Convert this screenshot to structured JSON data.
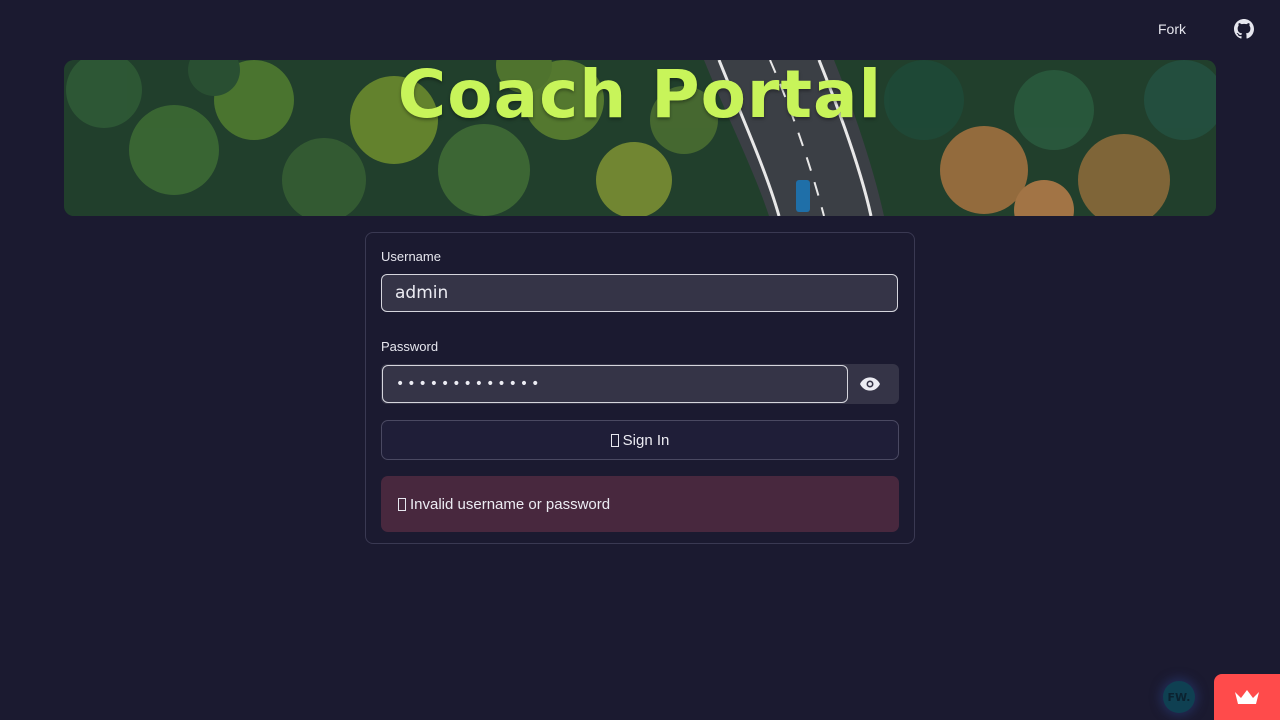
{
  "header": {
    "fork_label": "Fork",
    "github_icon": "github-icon"
  },
  "banner": {
    "title": "Coach Portal",
    "title_color": "#c8f45a"
  },
  "login_form": {
    "username_label": "Username",
    "username_value": "admin",
    "password_label": "Password",
    "password_value": "•••••••••••••",
    "show_password_icon": "eye-icon",
    "sign_in_label": "Sign In",
    "error_message": "Invalid username or password",
    "error_color": "#48283e"
  },
  "footer_badges": {
    "fw_label": "FW.",
    "streamlit_icon": "crown-icon",
    "streamlit_color": "#ff4b4b"
  }
}
